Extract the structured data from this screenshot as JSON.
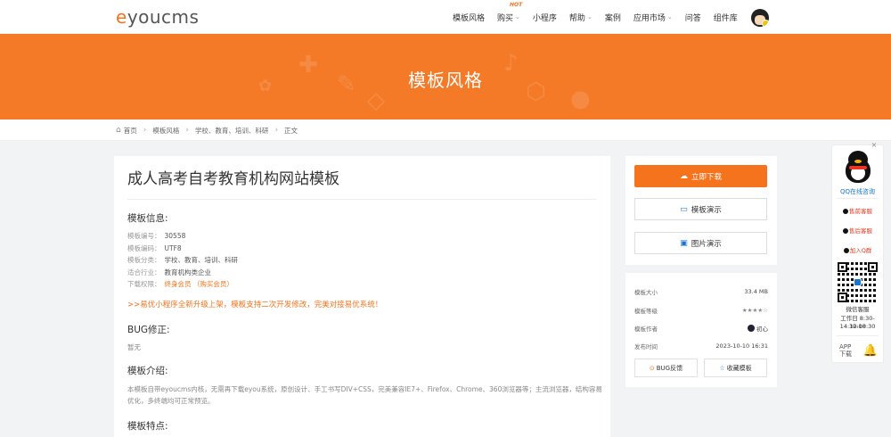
{
  "header": {
    "logo_brand": "e",
    "logo_rest": "youcms",
    "nav": [
      {
        "label": "模板风格",
        "chevron": false
      },
      {
        "label": "购买",
        "chevron": true,
        "badge": "HOT"
      },
      {
        "label": "小程序",
        "chevron": false
      },
      {
        "label": "帮助",
        "chevron": true
      },
      {
        "label": "案例",
        "chevron": false
      },
      {
        "label": "应用市场",
        "chevron": true
      },
      {
        "label": "问答",
        "chevron": false
      },
      {
        "label": "组件库",
        "chevron": false
      }
    ]
  },
  "banner": {
    "title": "模板风格",
    "color": "#f47a27"
  },
  "breadcrumb": [
    "首页",
    "模板风格",
    "学校、教育、培训、科研",
    "正文"
  ],
  "main": {
    "title": "成人高考自考教育机构网站模板",
    "info_heading": "模板信息:",
    "info": [
      {
        "k": "模板编号：",
        "v": "30558"
      },
      {
        "k": "模板编码：",
        "v": "UTF8"
      },
      {
        "k": "模板分类：",
        "v": "学校、教育、培训、科研"
      },
      {
        "k": "适合行业：",
        "v": "教育机构类企业"
      },
      {
        "k": "下载权限：",
        "v": "终身会员  （购买会员）"
      }
    ],
    "promo": ">>易优小程序全新升级上架，模板支持二次开发修改，完美对接易优系统！",
    "bug_heading": "BUG修正:",
    "bug_text": "暂无",
    "intro_heading": "模板介绍:",
    "intro_text": "本模板自带eyoucms内核，无需再下载eyou系统，原创设计、手工书写DIV+CSS，完美兼容IE7+、Firefox、Chrome、360浏览器等；主流浏览器，结构容易优化，多终端均可正常预览。",
    "features_heading": "模板特点:"
  },
  "side": {
    "download": "立即下载",
    "demo": "模板演示",
    "pictures": "图片演示",
    "meta": [
      {
        "k": "模板大小",
        "v": "33.4 MB"
      },
      {
        "k": "模板等级",
        "v": "★★★★☆"
      },
      {
        "k": "模板作者",
        "v": "初心"
      },
      {
        "k": "发布时间",
        "v": "2023-10-10 16:31"
      }
    ],
    "bug_btn": "BUG反馈",
    "fav_btn": "收藏模板"
  },
  "float": {
    "close": "×",
    "qq": "QQ在线咨询",
    "presale": "售前客服",
    "aftersale": "售后客服",
    "group": "加入Q群",
    "wechat": "微信客服",
    "hours1": "工作日 8:30-12:00",
    "hours2": "14:30-18:30",
    "app": "APP\n下载"
  },
  "colors": {
    "accent": "#f4731c",
    "link": "#1976d2"
  }
}
